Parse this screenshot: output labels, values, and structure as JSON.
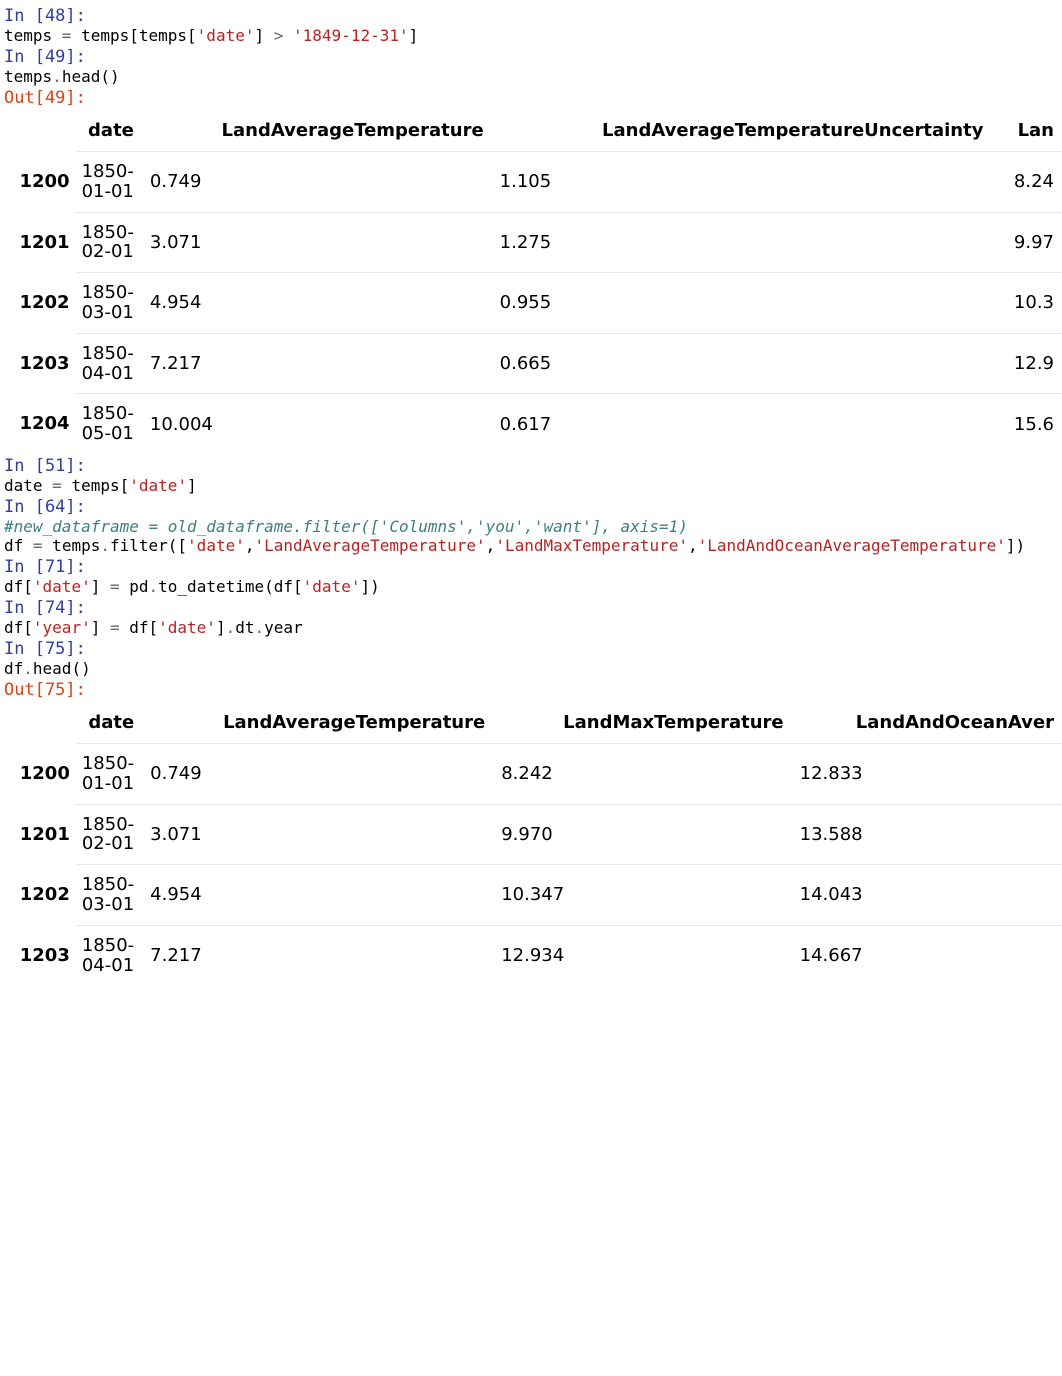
{
  "cells": {
    "c48": {
      "prompt": "In [48]:",
      "code": "temps = temps[temps['date'] > '1849-12-31']"
    },
    "c49": {
      "prompt": "In [49]:",
      "code": "temps.head()"
    },
    "o49": {
      "prompt": "Out[49]:"
    },
    "c51": {
      "prompt": "In [51]:",
      "code": "date = temps['date']"
    },
    "c64": {
      "prompt": "In [64]:",
      "line1": "#new_dataframe = old_dataframe.filter(['Columns','you','want'], axis=1)",
      "line2": "df = temps.filter(['date','LandAverageTemperature','LandMaxTemperature','LandAndOceanAverageTemperature'])"
    },
    "c71": {
      "prompt": "In [71]:",
      "code": "df['date'] = pd.to_datetime(df['date'])"
    },
    "c74": {
      "prompt": "In [74]:",
      "code": "df['year'] = df['date'].dt.year"
    },
    "c75": {
      "prompt": "In [75]:",
      "code": "df.head()"
    },
    "o75": {
      "prompt": "Out[75]:"
    }
  },
  "table1": {
    "columns": [
      "",
      "date",
      "LandAverageTemperature",
      "LandAverageTemperatureUncertainty",
      "Lan"
    ],
    "rows": [
      {
        "idx": "1200",
        "date": "1850-01-01",
        "c1": "0.749",
        "c2": "1.105",
        "c3": "8.24"
      },
      {
        "idx": "1201",
        "date": "1850-02-01",
        "c1": "3.071",
        "c2": "1.275",
        "c3": "9.97"
      },
      {
        "idx": "1202",
        "date": "1850-03-01",
        "c1": "4.954",
        "c2": "0.955",
        "c3": "10.3"
      },
      {
        "idx": "1203",
        "date": "1850-04-01",
        "c1": "7.217",
        "c2": "0.665",
        "c3": "12.9"
      },
      {
        "idx": "1204",
        "date": "1850-05-01",
        "c1": "10.004",
        "c2": "0.617",
        "c3": "15.6"
      }
    ]
  },
  "table2": {
    "columns": [
      "",
      "date",
      "LandAverageTemperature",
      "LandMaxTemperature",
      "LandAndOceanAver"
    ],
    "rows": [
      {
        "idx": "1200",
        "date": "1850-01-01",
        "c1": "0.749",
        "c2": "8.242",
        "c3": "12.833"
      },
      {
        "idx": "1201",
        "date": "1850-02-01",
        "c1": "3.071",
        "c2": "9.970",
        "c3": "13.588"
      },
      {
        "idx": "1202",
        "date": "1850-03-01",
        "c1": "4.954",
        "c2": "10.347",
        "c3": "14.043"
      },
      {
        "idx": "1203",
        "date": "1850-04-01",
        "c1": "7.217",
        "c2": "12.934",
        "c3": "14.667"
      }
    ]
  }
}
